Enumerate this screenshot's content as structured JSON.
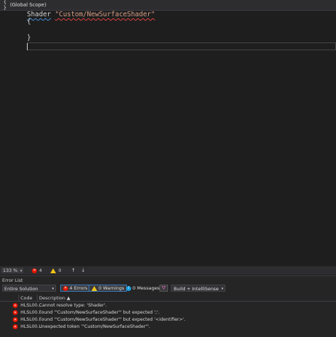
{
  "scope_bar": {
    "icon": "braces-icon",
    "icon_text": "{ }",
    "scope": "(Global Scope)"
  },
  "editor": {
    "line1_keyword": "Shader",
    "line1_string": "\"Custom/NewSurfaceShader\"",
    "line2": "{",
    "line3": "",
    "line4": "}"
  },
  "status_bar": {
    "zoom": "133 %",
    "error_count": "4",
    "warning_count": "0",
    "up_arrow": "↑",
    "down_arrow": "↓"
  },
  "error_list": {
    "title": "Error List",
    "scope_select": "Entire Solution",
    "errors_button": "4 Errors",
    "warnings_button": "0 Warnings",
    "messages_button": "0 Messages",
    "build_select": "Build + IntelliSense",
    "columns": {
      "code": "Code",
      "description": "Description"
    },
    "rows": [
      {
        "code": "HLSL00...",
        "description": "Cannot resolve type: 'Shader'."
      },
      {
        "code": "HLSL00...",
        "description": "Found '\"Custom/NewSurfaceShader\"' but expected ';'."
      },
      {
        "code": "HLSL00...",
        "description": "Found '\"Custom/NewSurfaceShader\"' but expected '<identifier>'."
      },
      {
        "code": "HLSL00...",
        "description": "Unexpected token '\"Custom/NewSurfaceShader\"'."
      }
    ]
  },
  "colors": {
    "editor_bg": "#1e1e1e",
    "error_red": "#e51400",
    "warning_yellow": "#f0c419",
    "info_blue": "#1ba1e2",
    "string_color": "#d69d85"
  }
}
